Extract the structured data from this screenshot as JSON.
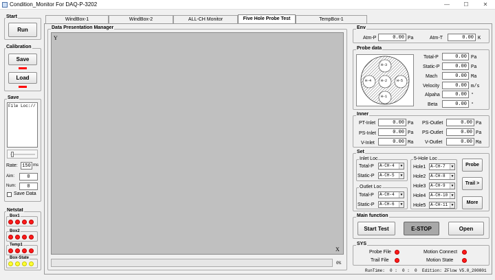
{
  "window": {
    "title": "Condition_Monitor For DAQ-P-3202",
    "min": "—",
    "max": "☐",
    "close": "✕"
  },
  "left": {
    "start": {
      "title": "Start",
      "run": "Run"
    },
    "calibration": {
      "title": "Calibration",
      "save": "Save",
      "load": "Load"
    },
    "save": {
      "title": "Save",
      "file_loc": "File Loc://",
      "rate_label": "Rate:",
      "rate_value": "150",
      "rate_unit": "ms",
      "aim_label": "Aim:",
      "aim_value": "0",
      "num_label": "Num:",
      "num_value": "0",
      "save_data": "Save Data"
    },
    "netstat": {
      "title": "Netstat",
      "box1": "Box1",
      "box2": "Box2",
      "temp1": "Temp1",
      "box_state": "Box-State"
    }
  },
  "tabs": [
    "WindBox-1",
    "WindBox-2",
    "ALL-CH Monitor",
    "Five Hole Probe Test",
    "TempBox-1"
  ],
  "dpm": {
    "title": "Data Presentation Manager",
    "y": "Y",
    "x": "X",
    "progress": "0%"
  },
  "env": {
    "title": "Env",
    "atmp_label": "Atm-P",
    "atmp_value": "0.00",
    "atmp_unit": "Pa",
    "atmt_label": "Atm-T",
    "atmt_value": "0.00",
    "atmt_unit": "K"
  },
  "probe": {
    "title": "Probe data",
    "holes": [
      "H-3",
      "H-4",
      "H-2",
      "H-5",
      "H-1"
    ],
    "rows": [
      {
        "label": "Total-P",
        "value": "0.00",
        "unit": "Pa"
      },
      {
        "label": "Static-P",
        "value": "0.00",
        "unit": "Pa"
      },
      {
        "label": "Mach",
        "value": "0.00",
        "unit": "Ma"
      },
      {
        "label": "Velocity",
        "value": "0.00",
        "unit": "m/s"
      },
      {
        "label": "Alpaha",
        "value": "0.00",
        "unit": "°"
      },
      {
        "label": "Beta",
        "value": "0.00",
        "unit": "°"
      }
    ]
  },
  "inner": {
    "title": "Inner",
    "left": [
      {
        "label": "PT-Inlet",
        "value": "0.00",
        "unit": "Pa"
      },
      {
        "label": "PS-Inlet",
        "value": "0.00",
        "unit": "Pa"
      },
      {
        "label": "V-Inlet",
        "value": "0.00",
        "unit": "Ma"
      }
    ],
    "right": [
      {
        "label": "PS-Outlet",
        "value": "0.00",
        "unit": "Pa"
      },
      {
        "label": "PS-Outlet",
        "value": "0.00",
        "unit": "Pa"
      },
      {
        "label": "V-Outlet",
        "value": "0.00",
        "unit": "Ma"
      }
    ]
  },
  "set": {
    "title": "Set",
    "inlet_loc": "Inlet Loc",
    "outlet_loc": "Outlet Loc",
    "hole_loc": "5-Hole Loc",
    "inlet": [
      {
        "label": "Total-P",
        "value": "A-CH-4"
      },
      {
        "label": "Static-P",
        "value": "A-CH-5"
      }
    ],
    "outlet": [
      {
        "label": "Total-P",
        "value": "A-CH-4"
      },
      {
        "label": "Static-P",
        "value": "A-CH-6"
      }
    ],
    "holes": [
      {
        "label": "Hole1",
        "value": "A-CH-7"
      },
      {
        "label": "Hole2",
        "value": "A-CH-8"
      },
      {
        "label": "Hole3",
        "value": "A-CH-9"
      },
      {
        "label": "Hole4",
        "value": "A-CH-10"
      },
      {
        "label": "Hole5",
        "value": "A-CH-11"
      }
    ],
    "probe_btn": "Probe",
    "trail_btn": "Trail >",
    "more_btn": "More"
  },
  "main": {
    "title": "Main function",
    "start_test": "Start Test",
    "estop": "E-STOP",
    "open": "Open"
  },
  "sys": {
    "title": "SYS",
    "probe_file": "Probe File",
    "trail_file": "Trail File",
    "motion_connect": "Motion Connect",
    "motion_state": "Motion State"
  },
  "status": {
    "runtime_label": "RunTime:",
    "runtime": "0 :  0 :  0",
    "edition": "Edition: ZFlow V5.0_200801"
  }
}
